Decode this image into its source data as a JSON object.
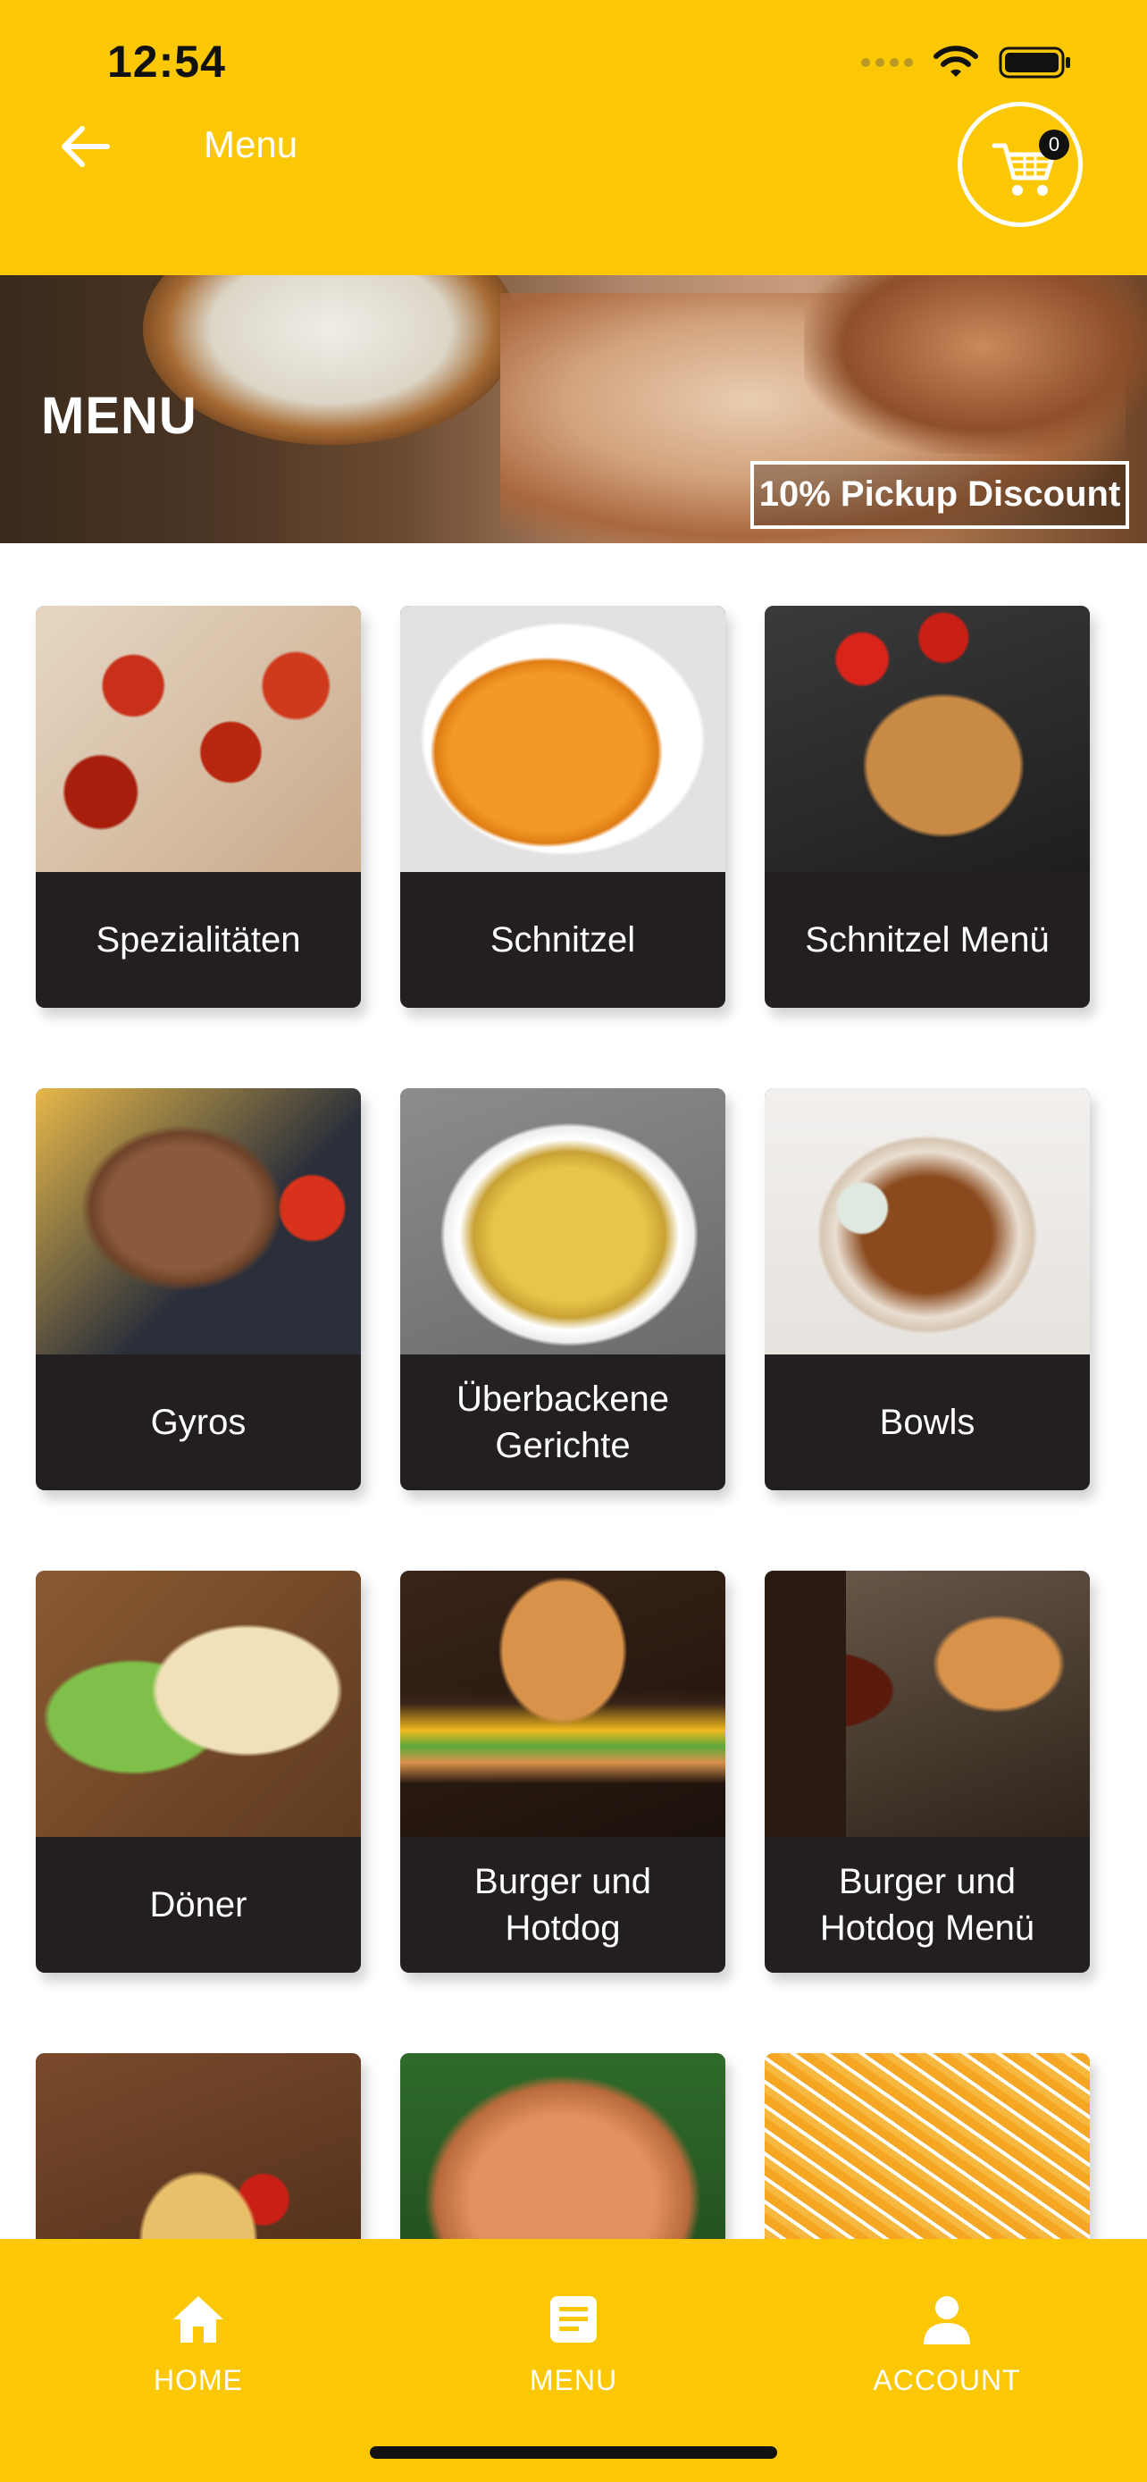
{
  "status_bar": {
    "time": "12:54"
  },
  "header": {
    "title": "Menu",
    "cart_count": "0"
  },
  "banner": {
    "title": "MENU",
    "badge": "10% Pickup Discount"
  },
  "categories": [
    {
      "label": "Spezialitäten"
    },
    {
      "label": "Schnitzel"
    },
    {
      "label": "Schnitzel Menü"
    },
    {
      "label": "Gyros"
    },
    {
      "label": "Überbackene Gerichte"
    },
    {
      "label": "Bowls"
    },
    {
      "label": "Döner"
    },
    {
      "label": "Burger und Hotdog"
    },
    {
      "label": "Burger und Hotdog Menü"
    }
  ],
  "bottom_nav": {
    "home": "HOME",
    "menu": "MENU",
    "account": "ACCOUNT"
  },
  "colors": {
    "accent": "#fcc806",
    "tile_bg": "#231f20"
  }
}
